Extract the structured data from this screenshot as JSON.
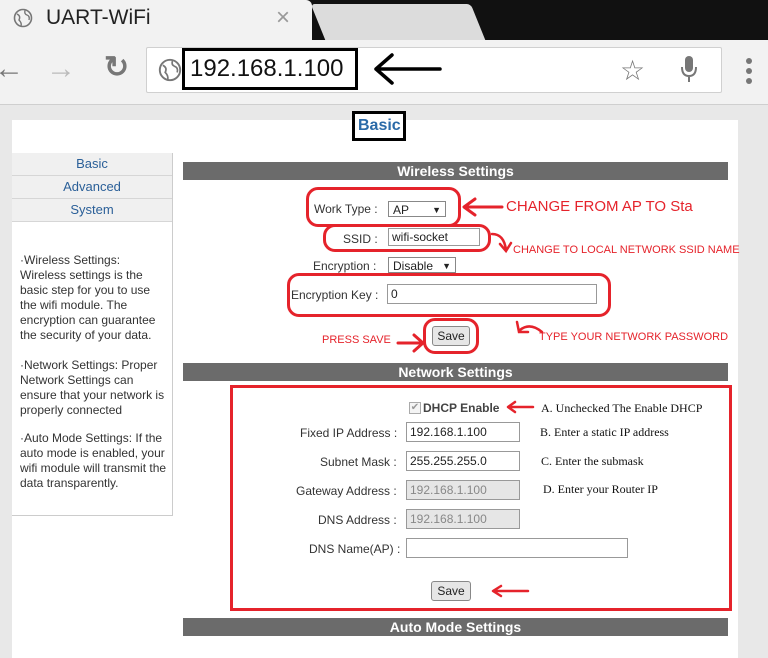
{
  "browser": {
    "tab_title": "UART-WiFi",
    "tab_close": "×",
    "url": "192.168.1.100",
    "back": "←",
    "forward": "→",
    "reload": "↻",
    "star": "☆",
    "menu": "⋮",
    "url_arrow_color": "#000000"
  },
  "page": {
    "title": "Basic"
  },
  "sidebar": {
    "items": [
      "Basic",
      "Advanced",
      "System"
    ],
    "help": [
      "·Wireless Settings: Wireless settings is the basic step for you to use the wifi module. The encryption can guarantee the security of your data.",
      "·Network Settings: Proper Network Settings can ensure that your network is properly connected",
      "·Auto Mode Settings: If the auto mode is enabled, your wifi module will transmit the data transparently."
    ]
  },
  "wireless": {
    "header": "Wireless Settings",
    "work_type_label": "Work Type :",
    "work_type_value": "AP",
    "ssid_label": "SSID :",
    "ssid_value": "wifi-socket",
    "encryption_label": "Encryption :",
    "encryption_value": "Disable",
    "enc_key_label": "Encryption Key :",
    "enc_key_value": "0",
    "save_label": "Save"
  },
  "network": {
    "header": "Network Settings",
    "dhcp_label": "DHCP Enable",
    "fixed_ip_label": "Fixed IP Address :",
    "fixed_ip_value": "192.168.1.100",
    "subnet_label": "Subnet Mask :",
    "subnet_value": "255.255.255.0",
    "gateway_label": "Gateway Address :",
    "gateway_value": "192.168.1.100",
    "dns_label": "DNS Address :",
    "dns_value": "192.168.1.100",
    "dns_name_label": "DNS Name(AP) :",
    "dns_name_value": "",
    "save_label": "Save"
  },
  "auto_mode": {
    "header": "Auto Mode Settings"
  },
  "annotations": {
    "work_type": "CHANGE FROM AP TO Sta",
    "ssid": "CHANGE TO LOCAL NETWORK SSID NAME",
    "press_save": "PRESS SAVE",
    "password": "TYPE YOUR NETWORK PASSWORD",
    "a": "A. Unchecked The Enable DHCP",
    "b": "B.  Enter a static IP address",
    "c": "C. Enter the submask",
    "d": "D. Enter your Router IP",
    "color": "#e5232b"
  }
}
